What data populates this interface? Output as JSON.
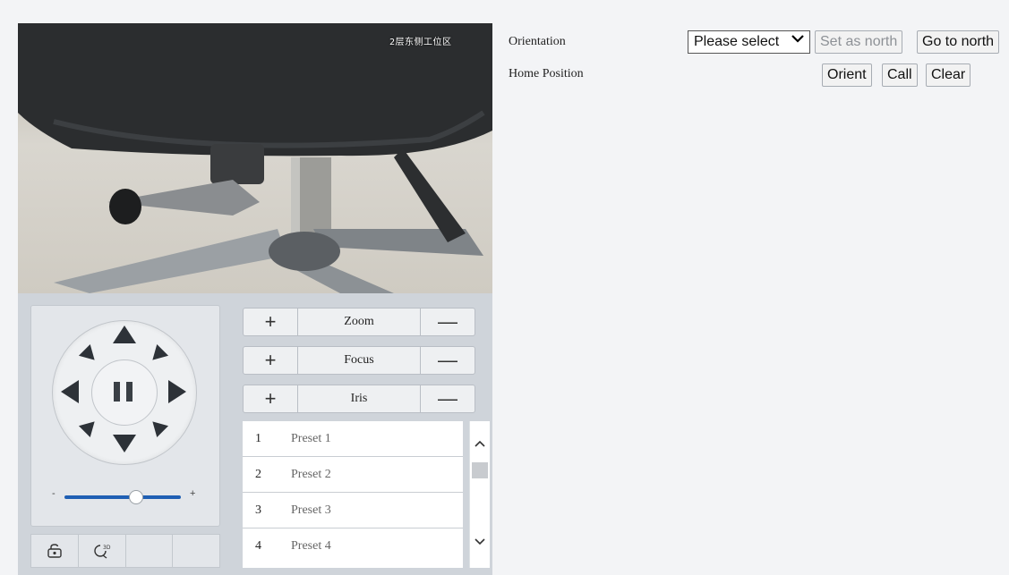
{
  "video": {
    "osd_text": "2层东侧工位区"
  },
  "ptz": {
    "directions": [
      "up",
      "down",
      "left",
      "right",
      "up-left",
      "up-right",
      "down-left",
      "down-right"
    ],
    "center_icon": "pause-icon",
    "speed": {
      "minus": "-",
      "plus": "+",
      "value_fraction": 0.65
    },
    "tools": [
      "lock-camera-icon",
      "3d-positioning-icon",
      "",
      ""
    ]
  },
  "lens": {
    "rows": [
      {
        "plus": "+",
        "label": "Zoom",
        "minus": "—"
      },
      {
        "plus": "+",
        "label": "Focus",
        "minus": "—"
      },
      {
        "plus": "+",
        "label": "Iris",
        "minus": "—"
      }
    ]
  },
  "presets": [
    {
      "num": "1",
      "name": "Preset 1"
    },
    {
      "num": "2",
      "name": "Preset 2"
    },
    {
      "num": "3",
      "name": "Preset 3"
    },
    {
      "num": "4",
      "name": "Preset 4"
    }
  ],
  "scroll": {
    "up": "^",
    "down": "⌄"
  },
  "settings": {
    "orientation_label": "Orientation",
    "orientation_select": "Please select",
    "set_north": "Set as north",
    "go_north": "Go to north",
    "home_label": "Home Position",
    "orient": "Orient",
    "call": "Call",
    "clear": "Clear"
  }
}
